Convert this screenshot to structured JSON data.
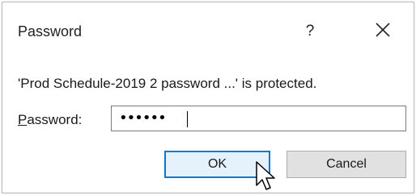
{
  "dialog": {
    "title": "Password",
    "help_label": "?",
    "close_icon": "close-icon",
    "message": "'Prod Schedule-2019 2 password ...' is protected.",
    "password_label_accel": "P",
    "password_label_rest": "assword:",
    "password_value": "••••••",
    "ok_label": "OK",
    "cancel_label": "Cancel",
    "cursor_icon": "mouse-pointer-icon"
  },
  "colors": {
    "ok_border": "#0078d7",
    "ok_fill": "#e5f1fb",
    "cancel_fill": "#e1e1e1"
  }
}
